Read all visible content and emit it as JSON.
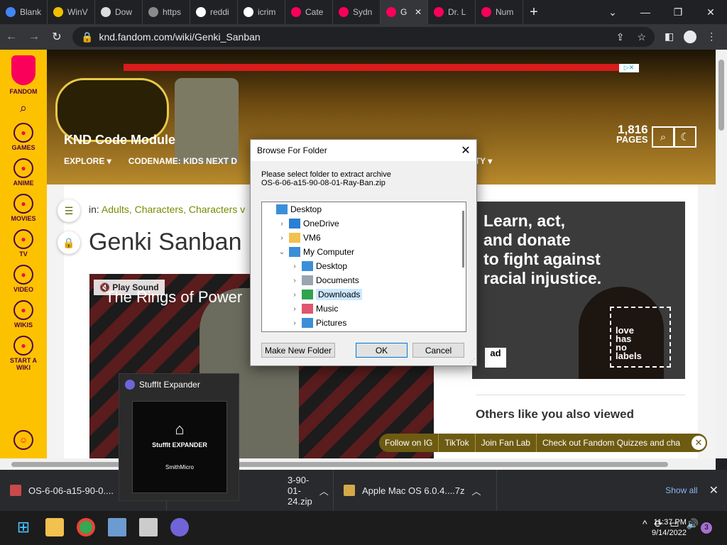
{
  "browser": {
    "tabs": [
      {
        "label": "Blank",
        "color": "#4285f4"
      },
      {
        "label": "WinV",
        "color": "#f0c000"
      },
      {
        "label": "Dow",
        "color": "#dddddd"
      },
      {
        "label": "https",
        "color": "#8a8a8a"
      },
      {
        "label": "reddi",
        "color": "#ffffff"
      },
      {
        "label": "icrim",
        "color": "#ffffff"
      },
      {
        "label": "Cate",
        "color": "#fa005a"
      },
      {
        "label": "Sydn",
        "color": "#fa005a"
      },
      {
        "label": "G",
        "color": "#fa005a",
        "active": true
      },
      {
        "label": "Dr. L",
        "color": "#fa005a"
      },
      {
        "label": "Num",
        "color": "#fa005a"
      }
    ],
    "new_tab": "+",
    "url": "knd.fandom.com/wiki/Genki_Sanban"
  },
  "fandom_rail": {
    "logo_label": "FANDOM",
    "items": [
      {
        "label": "GAMES",
        "icon": "gamepad-icon"
      },
      {
        "label": "ANIME",
        "icon": "anime-face-icon"
      },
      {
        "label": "MOVIES",
        "icon": "clapper-icon"
      },
      {
        "label": "TV",
        "icon": "tv-icon"
      },
      {
        "label": "VIDEO",
        "icon": "play-icon"
      },
      {
        "label": "WIKIS",
        "icon": "book-icon"
      },
      {
        "label": "START A\nWIKI",
        "icon": "plus-icon"
      }
    ]
  },
  "wiki": {
    "title": "KND Code Module",
    "nav": [
      "EXPLORE",
      "CODENAME: KIDS NEXT D",
      "UNITY"
    ],
    "pages_count": "1,816",
    "pages_label": "PAGES"
  },
  "article": {
    "crumb_prefix": "in:",
    "crumb_links": "Adults, Characters, Characters v",
    "title": "Genki Sanban",
    "video_title": "The Rings of Power",
    "play_sound": "Play Sound"
  },
  "ad": {
    "text": "Learn, act,\nand donate\nto fight against\nracial injustice.",
    "frame_text": "love\nhas\nno\nlabels",
    "logo_text": "ad"
  },
  "others_heading": "Others like you also viewed",
  "follow_bar": [
    "Follow on IG",
    "TikTok",
    "Join Fan Lab",
    "Check out Fandom Quizzes and cha"
  ],
  "dialog": {
    "title": "Browse For Folder",
    "prompt_line1": "Please select folder to extract archive",
    "prompt_line2": "OS-6-06-a15-90-08-01-Ray-Ban.zip",
    "tree": [
      {
        "label": "Desktop",
        "indent": 0,
        "expander": "",
        "icon_color": "#3b8fd8"
      },
      {
        "label": "OneDrive",
        "indent": 1,
        "expander": ">",
        "icon_color": "#2a7fd4"
      },
      {
        "label": "VM6",
        "indent": 1,
        "expander": ">",
        "icon_color": "#f2c14e"
      },
      {
        "label": "My Computer",
        "indent": 1,
        "expander": "v",
        "icon_color": "#3b8fd8"
      },
      {
        "label": "Desktop",
        "indent": 2,
        "expander": ">",
        "icon_color": "#3b8fd8"
      },
      {
        "label": "Documents",
        "indent": 2,
        "expander": ">",
        "icon_color": "#9aa5b1"
      },
      {
        "label": "Downloads",
        "indent": 2,
        "expander": ">",
        "icon_color": "#2ea44f",
        "selected": true
      },
      {
        "label": "Music",
        "indent": 2,
        "expander": ">",
        "icon_color": "#e0566d"
      },
      {
        "label": "Pictures",
        "indent": 2,
        "expander": ">",
        "icon_color": "#3b8fd8"
      }
    ],
    "make_folder": "Make New Folder",
    "ok": "OK",
    "cancel": "Cancel"
  },
  "stuffit_popup": {
    "title": "StuffIt Expander",
    "logo_line1": "StuffIt EXPANDER",
    "logo_line2": "SmithMicro"
  },
  "downloads": {
    "items": [
      "OS-6-06-a15-90-0....",
      "3-90-01-24.zip",
      "Apple Mac OS 6.0.4....7z"
    ],
    "show_all": "Show all"
  },
  "taskbar": {
    "time": "11:37 PM",
    "date": "9/14/2022",
    "notifications": "3"
  }
}
